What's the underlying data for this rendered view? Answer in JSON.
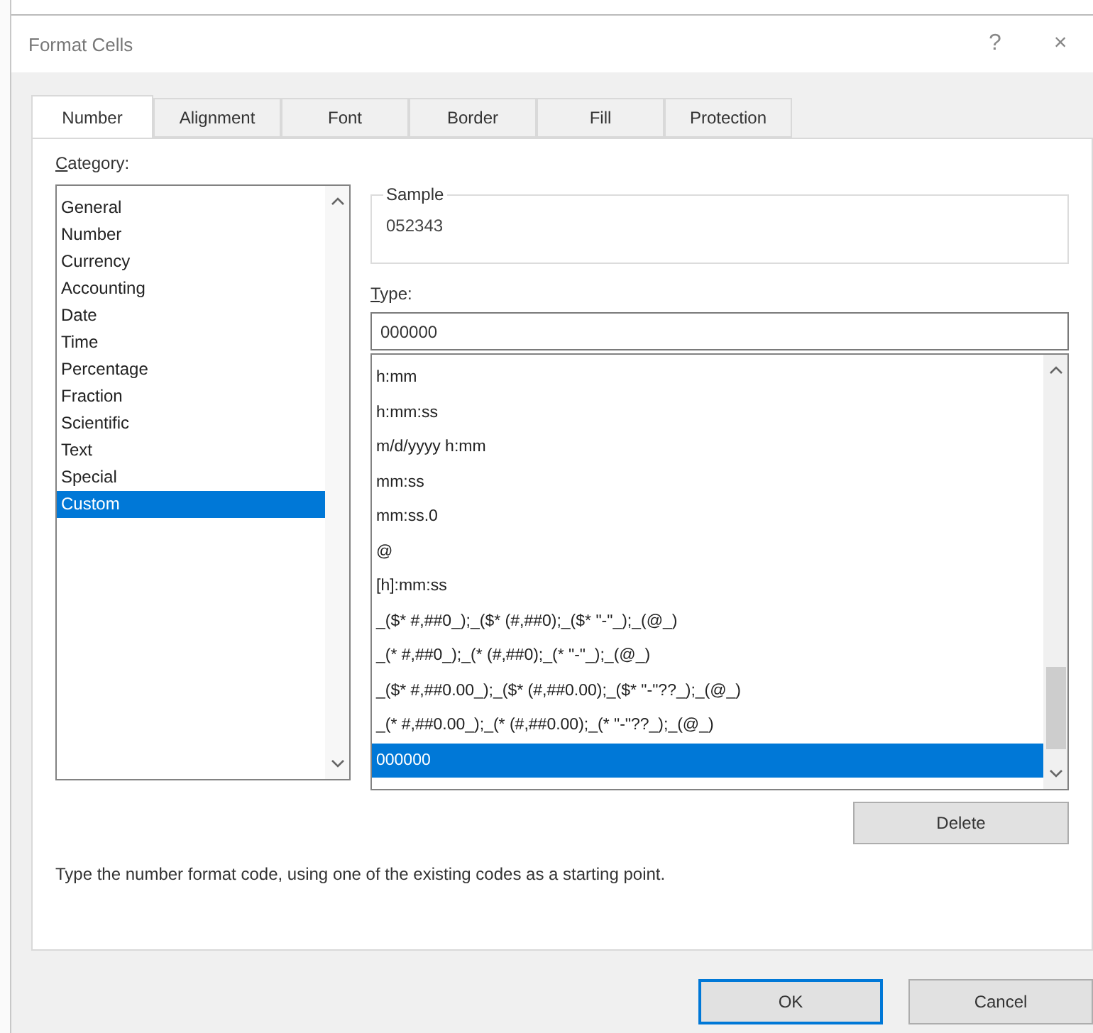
{
  "window": {
    "title": "Format Cells",
    "help": "?",
    "close": "×"
  },
  "tabs": [
    {
      "label": "Number",
      "selected": true
    },
    {
      "label": "Alignment",
      "selected": false
    },
    {
      "label": "Font",
      "selected": false
    },
    {
      "label": "Border",
      "selected": false
    },
    {
      "label": "Fill",
      "selected": false
    },
    {
      "label": "Protection",
      "selected": false
    }
  ],
  "category": {
    "label": "Category:",
    "items": [
      {
        "label": "General",
        "selected": false
      },
      {
        "label": "Number",
        "selected": false
      },
      {
        "label": "Currency",
        "selected": false
      },
      {
        "label": "Accounting",
        "selected": false
      },
      {
        "label": "Date",
        "selected": false
      },
      {
        "label": "Time",
        "selected": false
      },
      {
        "label": "Percentage",
        "selected": false
      },
      {
        "label": "Fraction",
        "selected": false
      },
      {
        "label": "Scientific",
        "selected": false
      },
      {
        "label": "Text",
        "selected": false
      },
      {
        "label": "Special",
        "selected": false
      },
      {
        "label": "Custom",
        "selected": true
      }
    ]
  },
  "sample": {
    "label": "Sample",
    "value": "052343"
  },
  "type": {
    "label": "Type:",
    "value": "000000",
    "items": [
      {
        "label": "h:mm",
        "selected": false
      },
      {
        "label": "h:mm:ss",
        "selected": false
      },
      {
        "label": "m/d/yyyy h:mm",
        "selected": false
      },
      {
        "label": "mm:ss",
        "selected": false
      },
      {
        "label": "mm:ss.0",
        "selected": false
      },
      {
        "label": "@",
        "selected": false
      },
      {
        "label": "[h]:mm:ss",
        "selected": false
      },
      {
        "label": "_($* #,##0_);_($* (#,##0);_($* \"-\"_);_(@_)",
        "selected": false
      },
      {
        "label": "_(* #,##0_);_(* (#,##0);_(* \"-\"_);_(@_)",
        "selected": false
      },
      {
        "label": "_($* #,##0.00_);_($* (#,##0.00);_($* \"-\"??_);_(@_)",
        "selected": false
      },
      {
        "label": "_(* #,##0.00_);_(* (#,##0.00);_(* \"-\"??_);_(@_)",
        "selected": false
      },
      {
        "label": "000000",
        "selected": true
      }
    ]
  },
  "delete_button": "Delete",
  "description": "Type the number format code, using one of the existing codes as a starting point.",
  "buttons": [
    {
      "label": "OK",
      "default": true
    },
    {
      "label": "Cancel",
      "default": false
    }
  ]
}
